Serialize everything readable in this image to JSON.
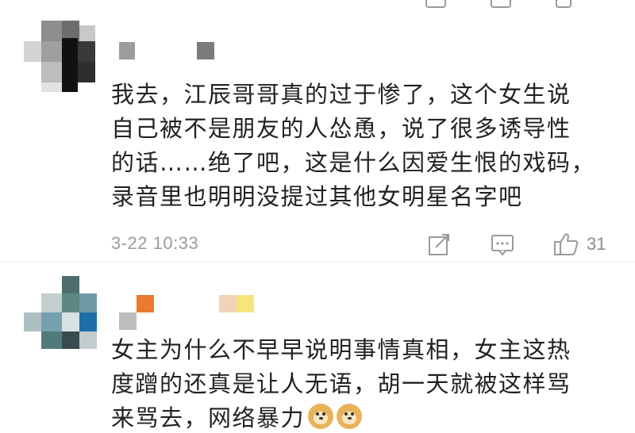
{
  "comments": [
    {
      "text_lines": [
        "我去，江辰哥哥真的过于惨了，这个女生说",
        "自己被不是朋友的人怂恿，说了很多诱导性",
        "的话……绝了吧，这是什么因爱生恨的戏码，",
        "录音里也明明没提过其他女明星名字吧"
      ],
      "timestamp": "3-22 10:33",
      "likes": "31",
      "icons": {
        "share": "share-icon",
        "reply": "comment-icon",
        "like": "thumbs-up-icon"
      }
    },
    {
      "text_lines": [
        "女主为什么不早早说明事情真相，女主这热",
        "度蹭的还真是让人无语，胡一天就被这样骂",
        "来骂去，网络暴力"
      ],
      "emoji": [
        "doge-emoji",
        "doge-emoji"
      ]
    }
  ],
  "colors": {
    "text": "#222222",
    "meta": "#9b9b9b",
    "icon": "#9a9a9a",
    "separator": "#eeeeee"
  }
}
